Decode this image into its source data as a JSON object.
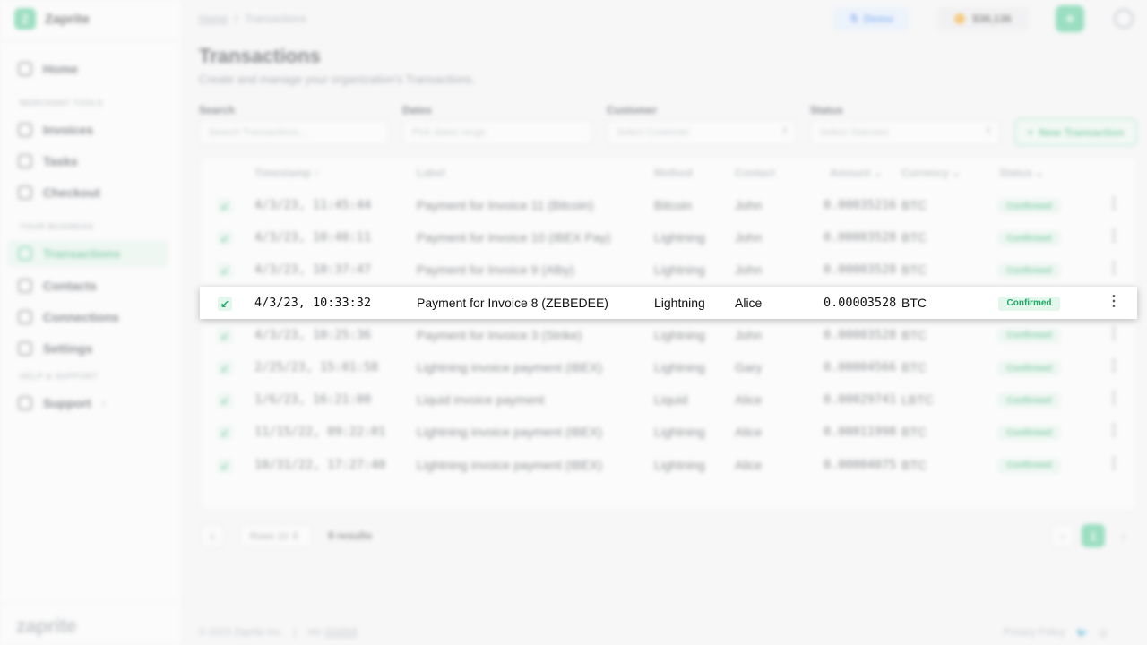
{
  "app": {
    "name": "Zaprite",
    "footer_logo": "zaprite"
  },
  "sidebar": {
    "sections": [
      "MERCHANT TOOLS",
      "YOUR BUSINESS",
      "HELP & SUPPORT"
    ],
    "items": [
      {
        "label": "Home",
        "icon": "home-icon"
      },
      {
        "label": "Invoices",
        "icon": "invoice-icon"
      },
      {
        "label": "Tasks",
        "icon": "tasks-icon"
      },
      {
        "label": "Checkout",
        "icon": "checkout-icon"
      },
      {
        "label": "Transactions",
        "icon": "transactions-icon",
        "active": true
      },
      {
        "label": "Contacts",
        "icon": "contacts-icon"
      },
      {
        "label": "Connections",
        "icon": "connections-icon"
      },
      {
        "label": "Settings",
        "icon": "settings-icon"
      },
      {
        "label": "Support",
        "icon": "support-icon"
      }
    ]
  },
  "topbar": {
    "breadcrumb": [
      "Home",
      "Transactions"
    ],
    "demo_label": "Demo",
    "balance": "$38,136",
    "add_label": "+"
  },
  "page": {
    "title": "Transactions",
    "subtitle": "Create and manage your organization's Transactions."
  },
  "filters": {
    "search": {
      "label": "Search",
      "placeholder": "Search Transactions..."
    },
    "dates": {
      "label": "Dates",
      "placeholder": "Pick dates range"
    },
    "customer": {
      "label": "Customer",
      "placeholder": "Select Customer"
    },
    "status": {
      "label": "Status",
      "placeholder": "Select Statuses"
    },
    "new_button": "New Transaction"
  },
  "table": {
    "headers": {
      "timestamp": "Timestamp",
      "label": "Label",
      "method": "Method",
      "contact": "Contact",
      "amount": "Amount",
      "currency": "Currency",
      "status": "Status"
    },
    "rows": [
      {
        "timestamp": "4/3/23, 11:45:44",
        "label": "Payment for Invoice 11 (Bitcoin)",
        "method": "Bitcoin",
        "contact": "John",
        "amount": "0.00035216",
        "currency": "BTC",
        "status": "Confirmed"
      },
      {
        "timestamp": "4/3/23, 10:40:11",
        "label": "Payment for Invoice 10 (IBEX Pay)",
        "method": "Lightning",
        "contact": "John",
        "amount": "0.00003528",
        "currency": "BTC",
        "status": "Confirmed"
      },
      {
        "timestamp": "4/3/23, 10:37:47",
        "label": "Payment for Invoice 9 (Alby)",
        "method": "Lightning",
        "contact": "John",
        "amount": "0.00003528",
        "currency": "BTC",
        "status": "Confirmed"
      },
      {
        "timestamp": "4/3/23, 10:33:32",
        "label": "Payment for Invoice 8 (ZEBEDEE)",
        "method": "Lightning",
        "contact": "Alice",
        "amount": "0.00003528",
        "currency": "BTC",
        "status": "Confirmed"
      },
      {
        "timestamp": "4/3/23, 10:25:36",
        "label": "Payment for Invoice 3 (Strike)",
        "method": "Lightning",
        "contact": "John",
        "amount": "0.00003528",
        "currency": "BTC",
        "status": "Confirmed"
      },
      {
        "timestamp": "2/25/23, 15:01:58",
        "label": "Lightning invoice payment (IBEX)",
        "method": "Lightning",
        "contact": "Gary",
        "amount": "0.00004566",
        "currency": "BTC",
        "status": "Confirmed"
      },
      {
        "timestamp": "1/6/23, 16:21:00",
        "label": "Liquid invoice payment",
        "method": "Liquid",
        "contact": "Alice",
        "amount": "0.00029741",
        "currency": "LBTC",
        "status": "Confirmed"
      },
      {
        "timestamp": "11/15/22, 09:22:01",
        "label": "Lightning invoice payment (IBEX)",
        "method": "Lightning",
        "contact": "Alice",
        "amount": "0.00011998",
        "currency": "BTC",
        "status": "Confirmed"
      },
      {
        "timestamp": "10/31/22, 17:27:40",
        "label": "Lightning invoice payment (IBEX)",
        "method": "Lightning",
        "contact": "Alice",
        "amount": "0.00004075",
        "currency": "BTC",
        "status": "Confirmed"
      }
    ],
    "direction_icon": "arrow-down-left-icon",
    "highlighted_row_index": 3
  },
  "pagination": {
    "rows_label": "Rows 10",
    "results": "9 results",
    "current_page": "1",
    "prev": "‹",
    "next": "›"
  },
  "footer": {
    "copyright": "© 2023 Zaprite Inc.",
    "version_label": "Ver",
    "version": "32d2b5",
    "privacy": "Privacy Policy"
  },
  "colors": {
    "accent": "#3cc68a",
    "demo": "#3b82f6",
    "coin": "#f59e0b"
  }
}
